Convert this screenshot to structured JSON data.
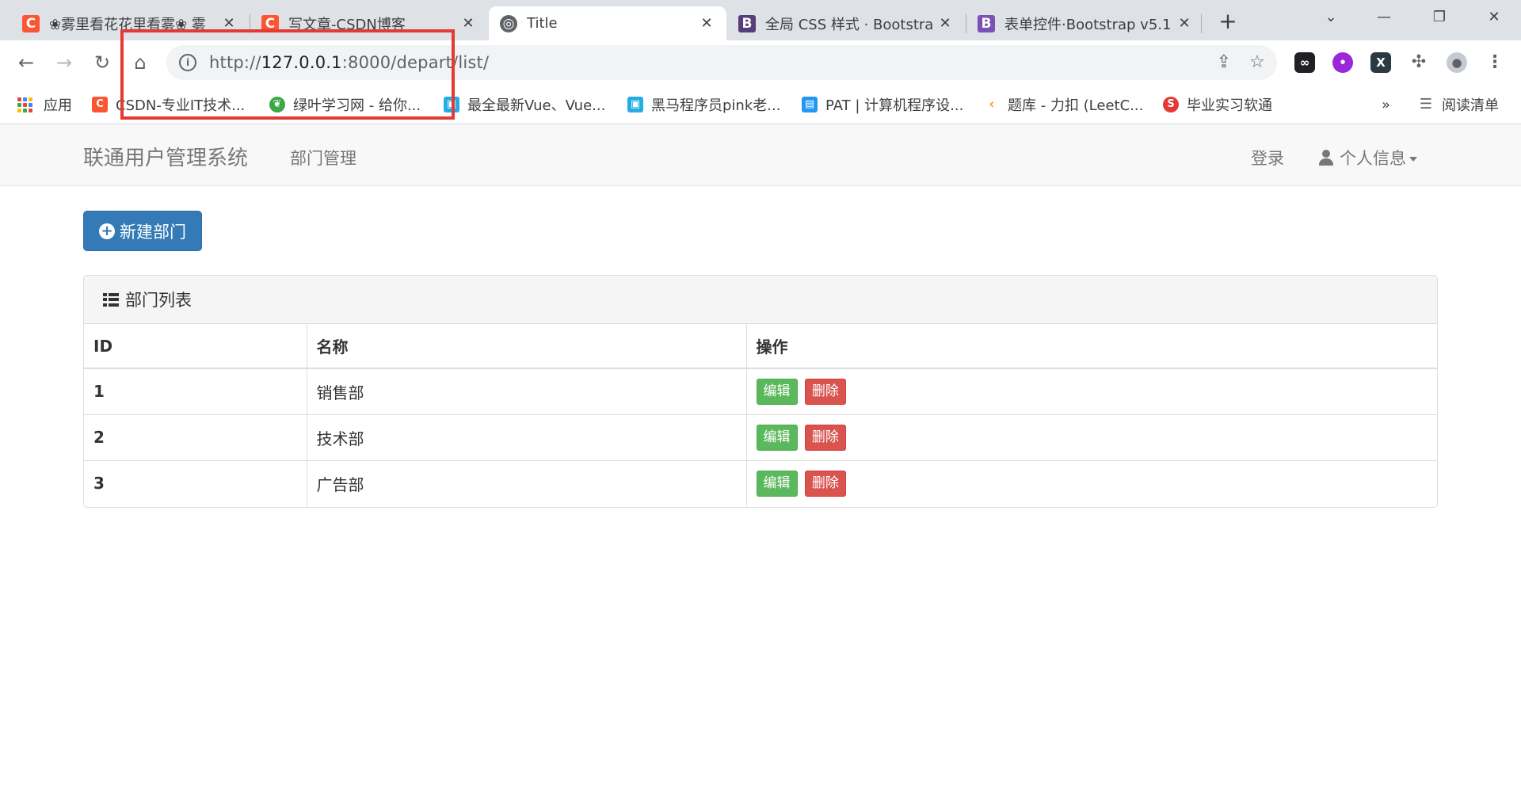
{
  "browser": {
    "tabs": [
      {
        "favicon": "C",
        "title": "❀雾里看花花里看雾❀ 雾",
        "active": false
      },
      {
        "favicon": "C",
        "title": "写文章-CSDN博客",
        "active": false
      },
      {
        "favicon": "globe",
        "title": "Title",
        "active": true
      },
      {
        "favicon": "B",
        "title": "全局 CSS 样式 · Bootstra",
        "active": false
      },
      {
        "favicon": "B",
        "title": "表单控件·Bootstrap v5.1",
        "active": false
      }
    ],
    "url_prefix": "http://",
    "url_host": "127.0.0.1",
    "url_rest": ":8000/depart/list/",
    "bookmarks": [
      {
        "icon": "apps-icon",
        "label": "应用"
      },
      {
        "icon": "csdn-icon",
        "label": "CSDN-专业IT技术..."
      },
      {
        "icon": "leaf-icon",
        "label": "绿叶学习网 - 给你..."
      },
      {
        "icon": "bilibili-icon",
        "label": "最全最新Vue、Vue..."
      },
      {
        "icon": "bilibili-icon",
        "label": "黑马程序员pink老..."
      },
      {
        "icon": "pat-icon",
        "label": "PAT | 计算机程序设..."
      },
      {
        "icon": "leetcode-icon",
        "label": "题库 - 力扣 (LeetC..."
      },
      {
        "icon": "school-icon",
        "label": "毕业实习软通"
      }
    ],
    "bookmarks_overflow": "»",
    "reading_list": "阅读清单"
  },
  "navbar": {
    "brand": "联通用户管理系统",
    "link_depart": "部门管理",
    "login": "登录",
    "profile": "个人信息"
  },
  "actions": {
    "new_depart": "新建部门"
  },
  "panel": {
    "title": "部门列表",
    "columns": [
      "ID",
      "名称",
      "操作"
    ],
    "rows": [
      {
        "id": "1",
        "name": "销售部",
        "edit": "编辑",
        "delete": "删除"
      },
      {
        "id": "2",
        "name": "技术部",
        "edit": "编辑",
        "delete": "删除"
      },
      {
        "id": "3",
        "name": "广告部",
        "edit": "编辑",
        "delete": "删除"
      }
    ]
  },
  "colors": {
    "primary": "#337ab7",
    "success": "#5cb85c",
    "danger": "#d9534f",
    "annotation": "#e53935"
  }
}
